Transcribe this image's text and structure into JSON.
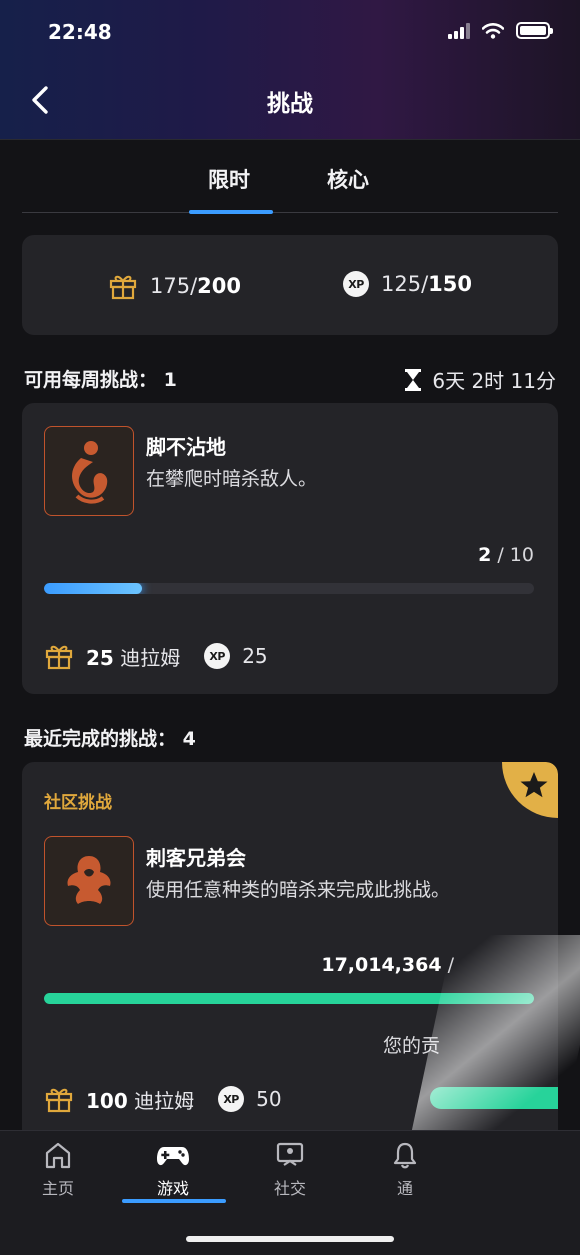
{
  "status_bar": {
    "time": "22:48"
  },
  "header": {
    "title": "挑战"
  },
  "tabs": [
    {
      "label": "限时"
    },
    {
      "label": "核心"
    }
  ],
  "summary": {
    "gift_current": "175",
    "gift_total": "200",
    "xp_label": "XP",
    "xp_current": "125",
    "xp_total": "150"
  },
  "weekly": {
    "label": "可用每周挑战：",
    "count": "1",
    "timer": "6天 2时 11分"
  },
  "challenge": {
    "title": "脚不沾地",
    "description": "在攀爬时暗杀敌人。",
    "progress_current": "2",
    "progress_total": " / 10",
    "progress_fraction": 0.2,
    "reward_amount": "25",
    "reward_currency": " 迪拉姆",
    "reward_xp": "25",
    "bar_color": "#3b9cff"
  },
  "recent": {
    "label": "最近完成的挑战：",
    "count": "4"
  },
  "community": {
    "label": "社区挑战",
    "title": "刺客兄弟会",
    "description": "使用任意种类的暗杀来完成此挑战。",
    "progress_current": "17,014,364",
    "progress_sep": " / ",
    "your_contribution": "您的贡",
    "reward_amount": "100",
    "reward_currency": " 迪拉姆",
    "reward_xp": "50",
    "bar_color": "#27d39a",
    "accent_color": "#e2b047"
  },
  "nav": [
    {
      "label": "主页",
      "icon": "home-icon"
    },
    {
      "label": "游戏",
      "icon": "gamepad-icon"
    },
    {
      "label": "社交",
      "icon": "social-icon"
    },
    {
      "label": "通",
      "icon": "bell-icon"
    }
  ]
}
